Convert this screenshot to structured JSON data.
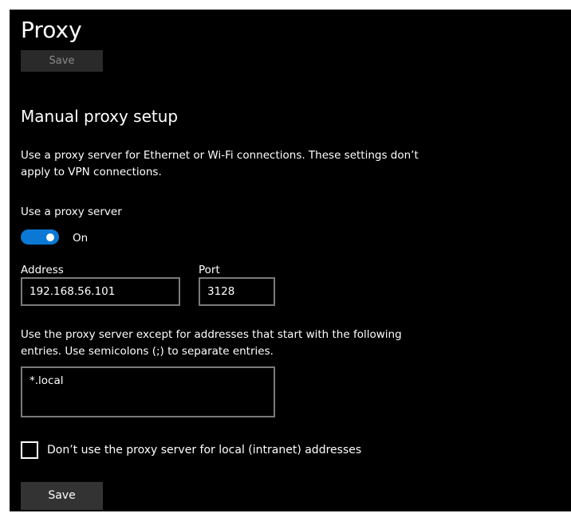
{
  "page": {
    "title": "Proxy",
    "save_top_label": "Save"
  },
  "manual": {
    "section_title": "Manual proxy setup",
    "description": "Use a proxy server for Ethernet or Wi-Fi connections. These settings don’t apply to VPN connections.",
    "use_proxy_label": "Use a proxy server",
    "toggle_state_label": "On",
    "toggle_on": true,
    "toggle_color": "#0a78d4",
    "address_label": "Address",
    "address_value": "192.168.56.101",
    "port_label": "Port",
    "port_value": "3128",
    "exceptions_description": "Use the proxy server except for addresses that start with the following entries. Use semicolons (;) to separate entries.",
    "exceptions_value": "*.local",
    "local_checkbox_label": "Don’t use the proxy server for local (intranet) addresses",
    "local_checkbox_checked": false,
    "save_label": "Save"
  }
}
